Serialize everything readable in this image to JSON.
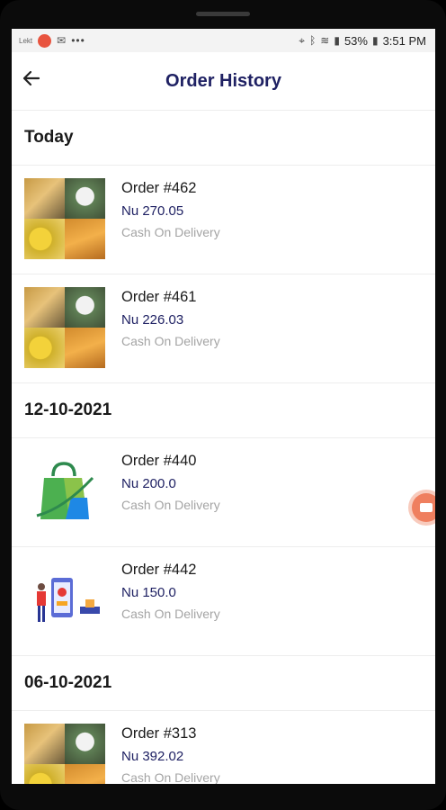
{
  "status_bar": {
    "left_label": "Lekt",
    "battery": "53%",
    "time": "3:51 PM"
  },
  "header": {
    "title": "Order History"
  },
  "sections": [
    {
      "date": "Today",
      "orders": [
        {
          "id": "Order #462",
          "price": "Nu 270.05",
          "payment": "Cash On Delivery",
          "thumb": "food-platter"
        },
        {
          "id": "Order #461",
          "price": "Nu 226.03",
          "payment": "Cash On Delivery",
          "thumb": "food-platter"
        }
      ]
    },
    {
      "date": "12-10-2021",
      "orders": [
        {
          "id": "Order #440",
          "price": "Nu 200.0",
          "payment": "Cash On Delivery",
          "thumb": "shopping-bag"
        },
        {
          "id": "Order #442",
          "price": "Nu 150.0",
          "payment": "Cash On Delivery",
          "thumb": "delivery-person"
        }
      ]
    },
    {
      "date": "06-10-2021",
      "orders": [
        {
          "id": "Order #313",
          "price": "Nu 392.02",
          "payment": "Cash On Delivery",
          "thumb": "food-platter"
        }
      ]
    }
  ],
  "colors": {
    "title": "#1f2163",
    "price": "#1f2163",
    "payment": "#a4a4a4",
    "fab": "#ef7f5f"
  },
  "icons": {
    "back": "arrow-left-icon",
    "floating": "video-record-icon"
  }
}
